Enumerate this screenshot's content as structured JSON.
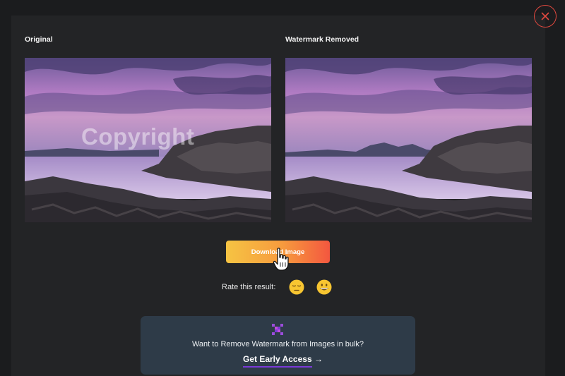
{
  "panel": {
    "original_label": "Original",
    "removed_label": "Watermark Removed"
  },
  "watermark_text": "Copyright",
  "actions": {
    "download_label": "Download Image"
  },
  "rating": {
    "label": "Rate this result:",
    "options": [
      "neutral-face",
      "grinning-face"
    ]
  },
  "bulk_promo": {
    "text": "Want to Remove Watermark from Images in bulk?",
    "cta_label": "Get Early Access",
    "cta_arrow": "→"
  },
  "colors": {
    "background": "#1b1c1e",
    "panel": "#232426",
    "close_accent": "#e0483f",
    "button_gradient": [
      "#f6c443",
      "#f79a3e",
      "#f3573f"
    ],
    "promo_box": "#2e3b48",
    "cta_underline": "#7a3ad8"
  },
  "icons": [
    "close-icon",
    "hand-pointer-cursor-icon",
    "grid-logo-icon",
    "arrow-right-icon"
  ]
}
